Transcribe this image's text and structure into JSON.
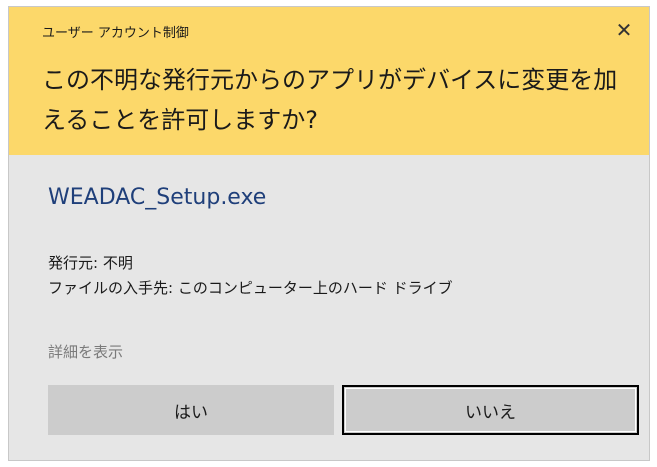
{
  "dialog": {
    "caption": "ユーザー アカウント制御",
    "close_glyph": "✕",
    "question": "この不明な発行元からのアプリがデバイスに変更を加えることを許可しますか?",
    "header_color": "#fcd86a",
    "body_color": "#e6e6e6"
  },
  "program": {
    "name": "WEADAC_Setup.exe",
    "publisher": "発行元: 不明",
    "origin": "ファイルの入手先: このコンピューター上のハード ドライブ"
  },
  "details_link": "詳細を表示",
  "buttons": {
    "yes": "はい",
    "no": "いいえ"
  }
}
